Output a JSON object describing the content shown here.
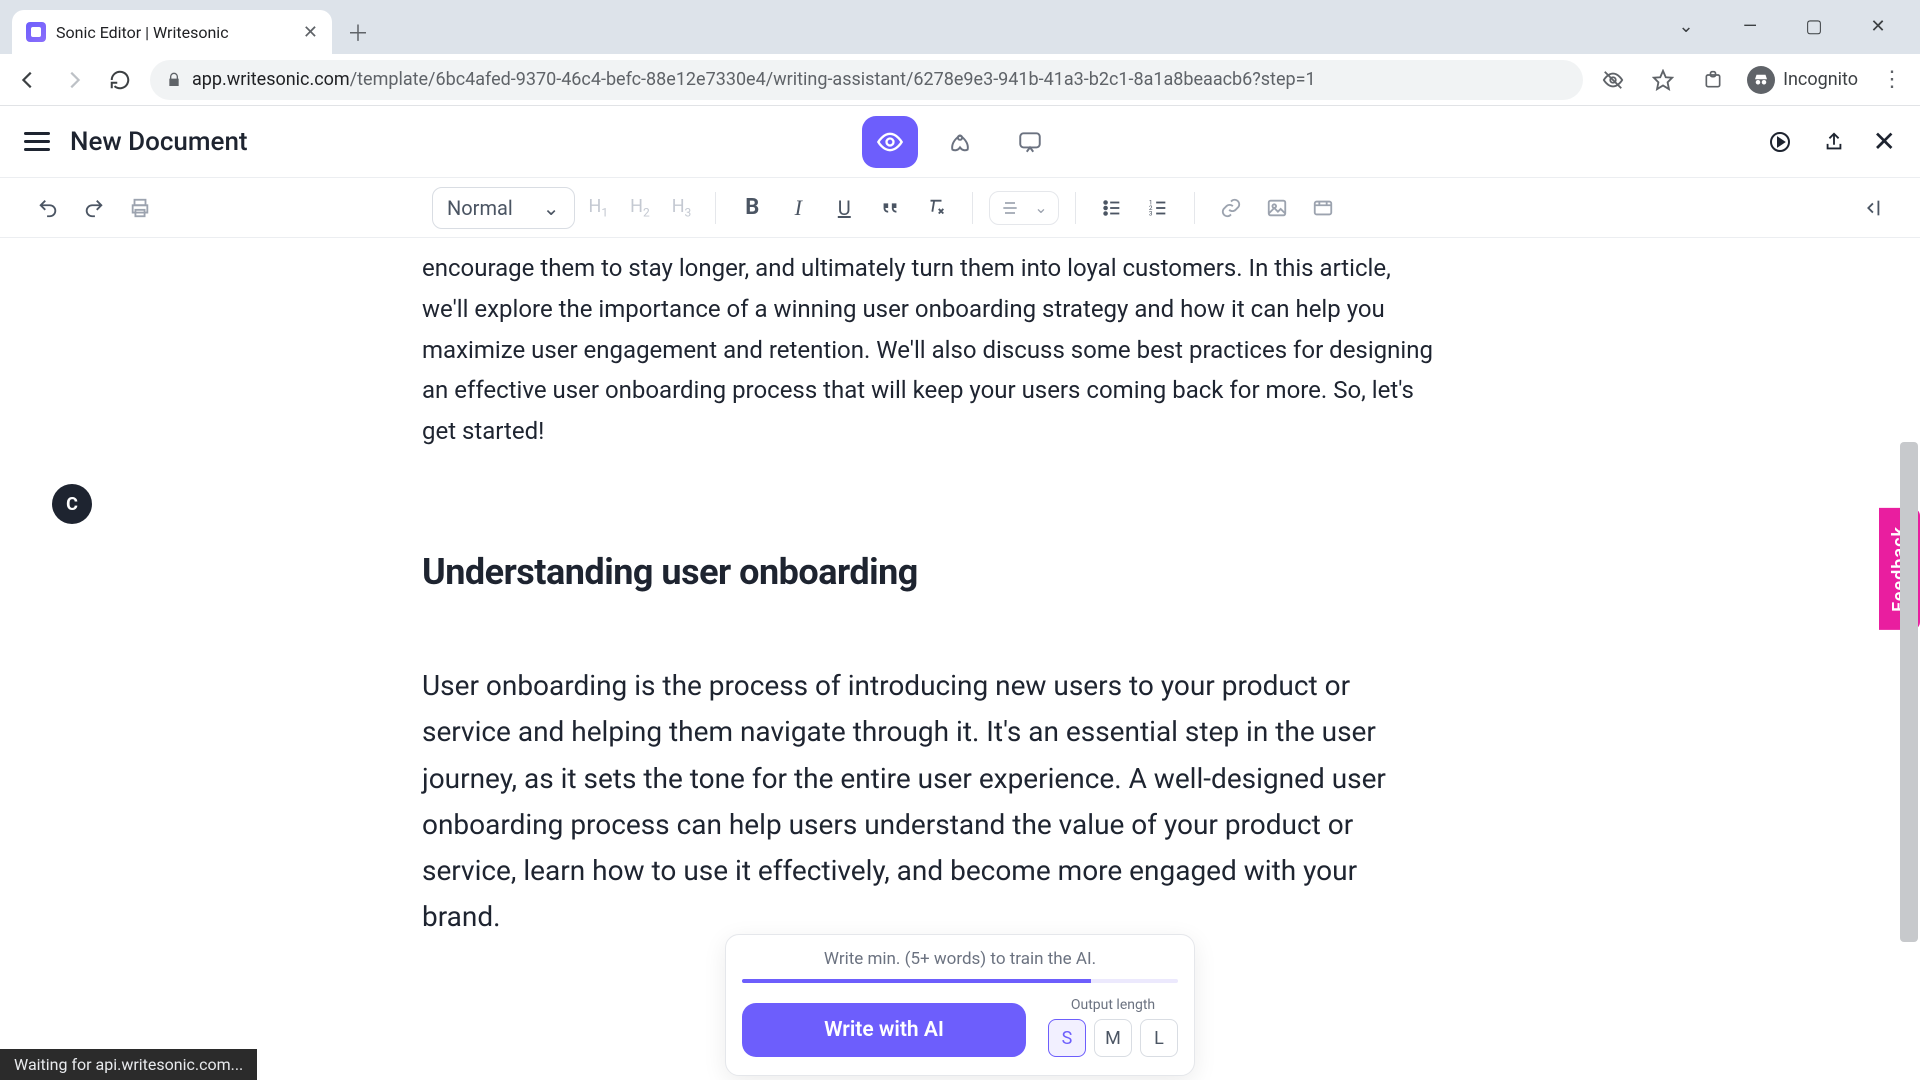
{
  "browser": {
    "tab_title": "Sonic Editor | Writesonic",
    "url_host": "app.writesonic.com",
    "url_rest": "/template/6bc4afed-9370-46c4-befc-88e12e7330e4/writing-assistant/6278e9e3-941b-41a3-b2c1-8a1a8beaacb6?step=1",
    "incognito_label": "Incognito",
    "status_text": "Waiting for api.writesonic.com..."
  },
  "header": {
    "doc_title": "New Document"
  },
  "toolbar": {
    "style_label": "Normal",
    "h1": "H",
    "h1s": "1",
    "h2": "H",
    "h2s": "2",
    "h3": "H",
    "h3s": "3"
  },
  "document": {
    "intro_partial": "encourage them to stay longer, and ultimately turn them into loyal customers. In this article, we'll explore the importance of a winning user onboarding strategy and how it can help you maximize user engagement and retention. We'll also discuss some best practices for designing an effective user onboarding process that will keep your users coming back for more. So, let's get started!",
    "heading": "Understanding user onboarding",
    "body_p1": "User onboarding is the process of introducing new users to your product or service and helping them navigate through it. It's an essential step in the user journey, as it sets the tone for the entire user experience. A well-designed user onboarding process can help users understand the value of your product or service, learn how to use it effectively, and become more engaged with your brand."
  },
  "ai": {
    "hint": "Write min. (5+ words) to train the AI.",
    "button": "Write with AI",
    "output_label": "Output length",
    "opts": {
      "s": "S",
      "m": "M",
      "l": "L"
    }
  },
  "feedback": {
    "label": "Feedback"
  },
  "gutter": {
    "label": "C"
  }
}
